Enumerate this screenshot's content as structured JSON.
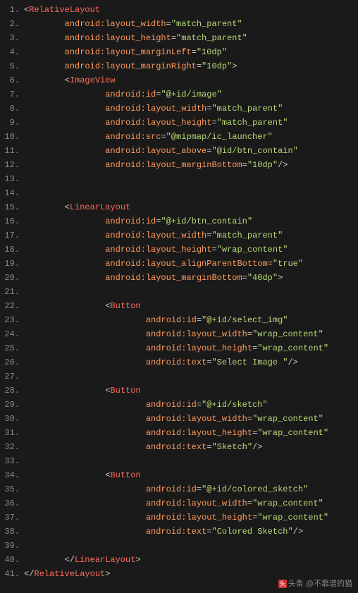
{
  "watermark_text": "@不靠谱的猫",
  "watermark_prefix": "头条",
  "lines": [
    {
      "n": 1,
      "indent": 0,
      "tokens": [
        [
          "punct",
          "<"
        ],
        [
          "tag",
          "RelativeLayout"
        ]
      ]
    },
    {
      "n": 2,
      "indent": 2,
      "tokens": [
        [
          "attr",
          "android:layout_width"
        ],
        [
          "punct",
          "="
        ],
        [
          "str",
          "\"match_parent\""
        ]
      ]
    },
    {
      "n": 3,
      "indent": 2,
      "tokens": [
        [
          "attr",
          "android:layout_height"
        ],
        [
          "punct",
          "="
        ],
        [
          "str",
          "\"match_parent\""
        ]
      ]
    },
    {
      "n": 4,
      "indent": 2,
      "tokens": [
        [
          "attr",
          "android:layout_marginLeft"
        ],
        [
          "punct",
          "="
        ],
        [
          "str",
          "\"10dp\""
        ]
      ]
    },
    {
      "n": 5,
      "indent": 2,
      "tokens": [
        [
          "attr",
          "android:layout_marginRight"
        ],
        [
          "punct",
          "="
        ],
        [
          "str",
          "\"10dp\""
        ],
        [
          "punct",
          ">"
        ]
      ]
    },
    {
      "n": 6,
      "indent": 2,
      "tokens": [
        [
          "punct",
          "<"
        ],
        [
          "tag",
          "ImageView"
        ]
      ]
    },
    {
      "n": 7,
      "indent": 4,
      "tokens": [
        [
          "attr",
          "android:id"
        ],
        [
          "punct",
          "="
        ],
        [
          "str",
          "\"@+id/image\""
        ]
      ]
    },
    {
      "n": 8,
      "indent": 4,
      "tokens": [
        [
          "attr",
          "android:layout_width"
        ],
        [
          "punct",
          "="
        ],
        [
          "str",
          "\"match_parent\""
        ]
      ]
    },
    {
      "n": 9,
      "indent": 4,
      "tokens": [
        [
          "attr",
          "android:layout_height"
        ],
        [
          "punct",
          "="
        ],
        [
          "str",
          "\"match_parent\""
        ]
      ]
    },
    {
      "n": 10,
      "indent": 4,
      "tokens": [
        [
          "attr",
          "android:src"
        ],
        [
          "punct",
          "="
        ],
        [
          "str",
          "\"@mipmap/ic_launcher\""
        ]
      ]
    },
    {
      "n": 11,
      "indent": 4,
      "tokens": [
        [
          "attr",
          "android:layout_above"
        ],
        [
          "punct",
          "="
        ],
        [
          "str",
          "\"@id/btn_contain\""
        ]
      ]
    },
    {
      "n": 12,
      "indent": 4,
      "tokens": [
        [
          "attr",
          "android:layout_marginBottom"
        ],
        [
          "punct",
          "="
        ],
        [
          "str",
          "\"10dp\""
        ],
        [
          "punct",
          "/>"
        ]
      ]
    },
    {
      "n": 13,
      "indent": 0,
      "tokens": []
    },
    {
      "n": 14,
      "indent": 0,
      "tokens": []
    },
    {
      "n": 15,
      "indent": 2,
      "tokens": [
        [
          "punct",
          "<"
        ],
        [
          "tag",
          "LinearLayout"
        ]
      ]
    },
    {
      "n": 16,
      "indent": 4,
      "tokens": [
        [
          "attr",
          "android:id"
        ],
        [
          "punct",
          "="
        ],
        [
          "str",
          "\"@+id/btn_contain\""
        ]
      ]
    },
    {
      "n": 17,
      "indent": 4,
      "tokens": [
        [
          "attr",
          "android:layout_width"
        ],
        [
          "punct",
          "="
        ],
        [
          "str",
          "\"match_parent\""
        ]
      ]
    },
    {
      "n": 18,
      "indent": 4,
      "tokens": [
        [
          "attr",
          "android:layout_height"
        ],
        [
          "punct",
          "="
        ],
        [
          "str",
          "\"wrap_content\""
        ]
      ]
    },
    {
      "n": 19,
      "indent": 4,
      "tokens": [
        [
          "attr",
          "android:layout_alignParentBottom"
        ],
        [
          "punct",
          "="
        ],
        [
          "str",
          "\"true\""
        ]
      ]
    },
    {
      "n": 20,
      "indent": 4,
      "tokens": [
        [
          "attr",
          "android:layout_marginBottom"
        ],
        [
          "punct",
          "="
        ],
        [
          "str",
          "\"40dp\""
        ],
        [
          "punct",
          ">"
        ]
      ]
    },
    {
      "n": 21,
      "indent": 0,
      "tokens": []
    },
    {
      "n": 22,
      "indent": 4,
      "tokens": [
        [
          "punct",
          "<"
        ],
        [
          "tag",
          "Button"
        ]
      ]
    },
    {
      "n": 23,
      "indent": 6,
      "tokens": [
        [
          "attr",
          "android:id"
        ],
        [
          "punct",
          "="
        ],
        [
          "str",
          "\"@+id/select_img\""
        ]
      ]
    },
    {
      "n": 24,
      "indent": 6,
      "tokens": [
        [
          "attr",
          "android:layout_width"
        ],
        [
          "punct",
          "="
        ],
        [
          "str",
          "\"wrap_content\""
        ]
      ]
    },
    {
      "n": 25,
      "indent": 6,
      "tokens": [
        [
          "attr",
          "android:layout_height"
        ],
        [
          "punct",
          "="
        ],
        [
          "str",
          "\"wrap_content\""
        ]
      ]
    },
    {
      "n": 26,
      "indent": 6,
      "tokens": [
        [
          "attr",
          "android:text"
        ],
        [
          "punct",
          "="
        ],
        [
          "str",
          "\"Select Image \""
        ],
        [
          "punct",
          "/>"
        ]
      ]
    },
    {
      "n": 27,
      "indent": 0,
      "tokens": []
    },
    {
      "n": 28,
      "indent": 4,
      "tokens": [
        [
          "punct",
          "<"
        ],
        [
          "tag",
          "Button"
        ]
      ]
    },
    {
      "n": 29,
      "indent": 6,
      "tokens": [
        [
          "attr",
          "android:id"
        ],
        [
          "punct",
          "="
        ],
        [
          "str",
          "\"@+id/sketch\""
        ]
      ]
    },
    {
      "n": 30,
      "indent": 6,
      "tokens": [
        [
          "attr",
          "android:layout_width"
        ],
        [
          "punct",
          "="
        ],
        [
          "str",
          "\"wrap_content\""
        ]
      ]
    },
    {
      "n": 31,
      "indent": 6,
      "tokens": [
        [
          "attr",
          "android:layout_height"
        ],
        [
          "punct",
          "="
        ],
        [
          "str",
          "\"wrap_content\""
        ]
      ]
    },
    {
      "n": 32,
      "indent": 6,
      "tokens": [
        [
          "attr",
          "android:text"
        ],
        [
          "punct",
          "="
        ],
        [
          "str",
          "\"Sketch\""
        ],
        [
          "punct",
          "/>"
        ]
      ]
    },
    {
      "n": 33,
      "indent": 0,
      "tokens": []
    },
    {
      "n": 34,
      "indent": 4,
      "tokens": [
        [
          "punct",
          "<"
        ],
        [
          "tag",
          "Button"
        ]
      ]
    },
    {
      "n": 35,
      "indent": 6,
      "tokens": [
        [
          "attr",
          "android:id"
        ],
        [
          "punct",
          "="
        ],
        [
          "str",
          "\"@+id/colored_sketch\""
        ]
      ]
    },
    {
      "n": 36,
      "indent": 6,
      "tokens": [
        [
          "attr",
          "android:layout_width"
        ],
        [
          "punct",
          "="
        ],
        [
          "str",
          "\"wrap_content\""
        ]
      ]
    },
    {
      "n": 37,
      "indent": 6,
      "tokens": [
        [
          "attr",
          "android:layout_height"
        ],
        [
          "punct",
          "="
        ],
        [
          "str",
          "\"wrap_content\""
        ]
      ]
    },
    {
      "n": 38,
      "indent": 6,
      "tokens": [
        [
          "attr",
          "android:text"
        ],
        [
          "punct",
          "="
        ],
        [
          "str",
          "\"Colored Sketch\""
        ],
        [
          "punct",
          "/>"
        ]
      ]
    },
    {
      "n": 39,
      "indent": 0,
      "tokens": []
    },
    {
      "n": 40,
      "indent": 2,
      "tokens": [
        [
          "punct",
          "</"
        ],
        [
          "tag",
          "LinearLayout"
        ],
        [
          "punct",
          ">"
        ]
      ]
    },
    {
      "n": 41,
      "indent": 0,
      "tokens": [
        [
          "punct",
          "</"
        ],
        [
          "tag",
          "RelativeLayout"
        ],
        [
          "punct",
          ">"
        ]
      ]
    }
  ]
}
